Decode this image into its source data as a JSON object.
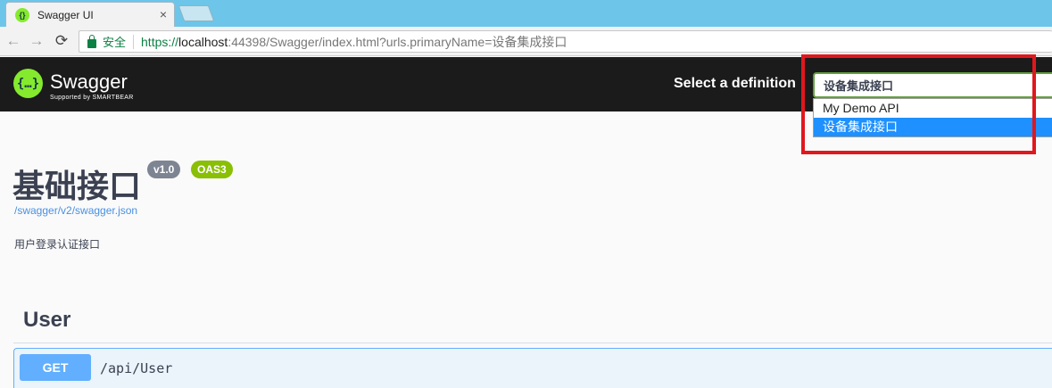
{
  "browser": {
    "tab_title": "Swagger UI",
    "tab_close": "×",
    "back_icon": "←",
    "forward_icon": "→",
    "reload_icon": "⟳",
    "secure_label": "安全",
    "url_scheme": "https://",
    "url_host": "localhost",
    "url_rest": ":44398/Swagger/index.html?urls.primaryName=设备集成接口"
  },
  "topbar": {
    "logo_glyph": "{…}",
    "logo_text": "Swagger",
    "logo_subtext": "Supported by SMARTBEAR",
    "definition_label": "Select a definition",
    "selected_definition": "设备集成接口",
    "options": [
      "My Demo API",
      "设备集成接口"
    ]
  },
  "info": {
    "title": "基础接口",
    "version": "v1.0",
    "oas_badge": "OAS3",
    "spec_url": "/swagger/v2/swagger.json",
    "description": "用户登录认证接口"
  },
  "tags": [
    {
      "name": "User",
      "operations": [
        {
          "method": "GET",
          "path": "/api/User"
        }
      ]
    }
  ],
  "colors": {
    "highlight": "#e1171e",
    "get_method": "#61affe",
    "selected_option": "#1e90ff",
    "swagger_green": "#85ea2d"
  }
}
